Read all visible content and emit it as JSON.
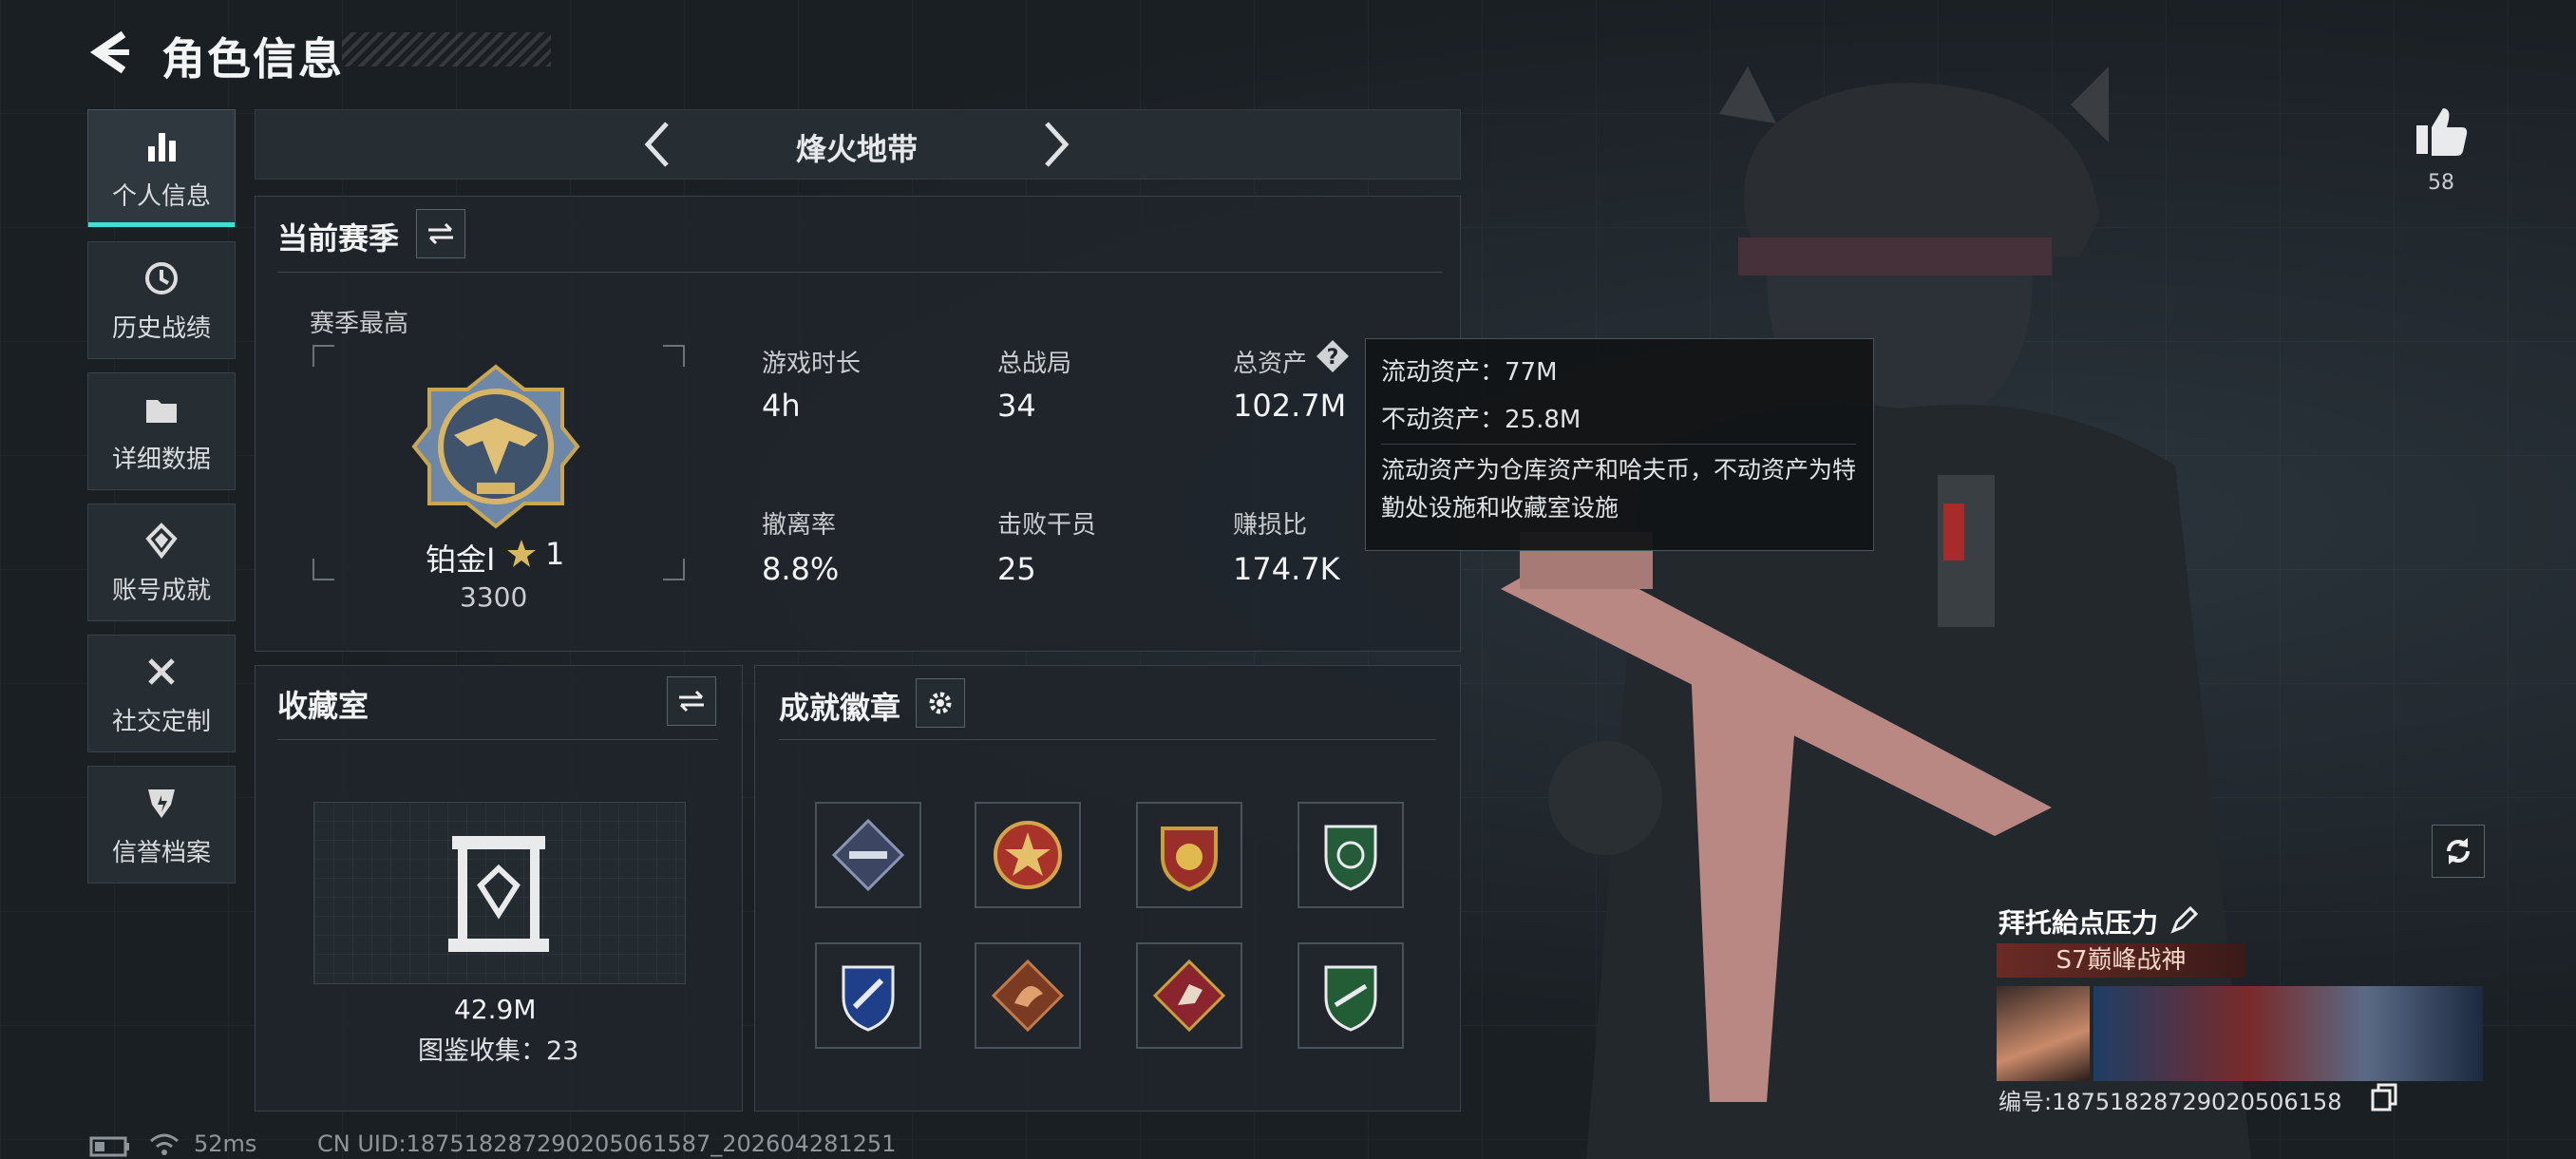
{
  "header": {
    "title": "角色信息"
  },
  "sidebar": {
    "items": [
      {
        "label": "个人信息",
        "icon": "bar-chart-icon",
        "active": true
      },
      {
        "label": "历史战绩",
        "icon": "history-icon"
      },
      {
        "label": "详细数据",
        "icon": "folder-icon"
      },
      {
        "label": "账号成就",
        "icon": "achievement-icon"
      },
      {
        "label": "社交定制",
        "icon": "tools-icon"
      },
      {
        "label": "信誉档案",
        "icon": "shield-icon"
      }
    ]
  },
  "mode_tab": {
    "title": "烽火地带"
  },
  "current_season": {
    "title": "当前赛季",
    "season_best_label": "赛季最高",
    "rank_name": "铂金Ⅰ",
    "rank_star_count": "1",
    "rank_score": "3300",
    "stats": [
      {
        "label": "游戏时长",
        "value": "4h"
      },
      {
        "label": "总战局",
        "value": "34"
      },
      {
        "label": "总资产",
        "value": "102.7M"
      },
      {
        "label": "撤离率",
        "value": "8.8%"
      },
      {
        "label": "击败干员",
        "value": "25"
      },
      {
        "label": "赚损比",
        "value": "174.7K"
      }
    ]
  },
  "tooltip": {
    "line1": "流动资产：77M",
    "line2": "不动资产：25.8M",
    "desc": "流动资产为仓库资产和哈夫币，不动资产为特勤处设施和收藏室设施"
  },
  "collection_room": {
    "title": "收藏室",
    "value": "42.9M",
    "count_text": "图鉴收集：23"
  },
  "achievements": {
    "title": "成就徽章",
    "badges": [
      {
        "name": "blade-diamond-badge",
        "color": "#8a95b5"
      },
      {
        "name": "star-medal-badge",
        "color": "#c0392b"
      },
      {
        "name": "shield-stars-badge",
        "color": "#c9a03a"
      },
      {
        "name": "green-shield-badge",
        "color": "#2e8b57"
      },
      {
        "name": "blue-wrench-badge",
        "color": "#2a5bb8"
      },
      {
        "name": "dragon-badge",
        "color": "#b8623a"
      },
      {
        "name": "runner-badge",
        "color": "#b0343a"
      },
      {
        "name": "green-gun-badge",
        "color": "#2e7d46"
      }
    ]
  },
  "profile": {
    "like_count": "58",
    "player_name": "拜托給点压力",
    "title_tag": "S7巅峰战神",
    "player_id": "编号:18751828729020506158"
  },
  "footer": {
    "ping": "52ms",
    "uid": "CN UID:18751828729020506158​7_202604281251"
  }
}
